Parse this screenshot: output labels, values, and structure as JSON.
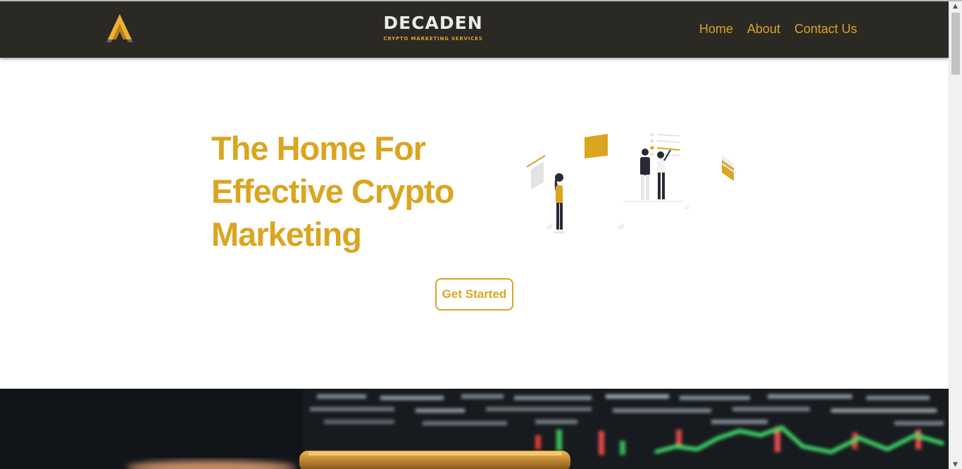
{
  "header": {
    "brand_name": "DECADEN",
    "brand_tagline": "CRYPTO MARKETING SERVICES",
    "nav": [
      {
        "label": "Home"
      },
      {
        "label": "About"
      },
      {
        "label": "Contact Us"
      }
    ]
  },
  "hero": {
    "title_lines": [
      "The Home For",
      "Effective Crypto",
      "Marketing"
    ],
    "cta_label": "Get Started"
  },
  "colors": {
    "accent": "#daa520",
    "navbar_bg": "#2b2924",
    "brand_text": "#ebebeb",
    "background": "#ffffff"
  },
  "icons": [
    "brand-logo-icon",
    "scroll-up-arrow-icon",
    "scroll-down-arrow-icon"
  ]
}
